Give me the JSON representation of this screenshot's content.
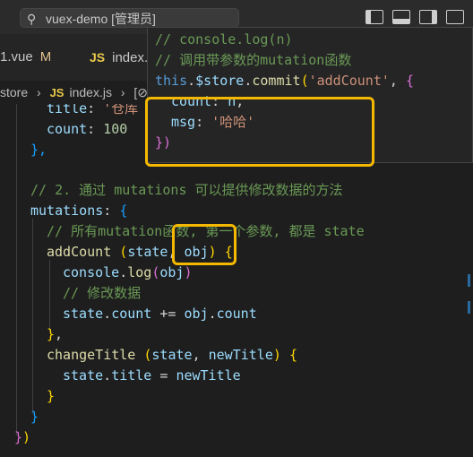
{
  "window": {
    "search_text": "vuex-demo [管理员]"
  },
  "tabs": [
    {
      "label": "1.vue",
      "modified": "M"
    },
    {
      "label": "index.j",
      "lang": "JS"
    }
  ],
  "breadcrumb": {
    "parts": [
      "store",
      "index.js",
      "[⊘]"
    ],
    "lang": "JS"
  },
  "code": {
    "line_title": {
      "key": "title",
      "value": "'仓库"
    },
    "line_count": {
      "key": "count",
      "value": "100"
    },
    "close_obj": "},",
    "comment2": "// 2. 通过 mutations 可以提供修改数据的方法",
    "mutations_key": "mutations",
    "comment_all": "// 所有mutation函数, 第一个参数, 都是 state",
    "addCount": {
      "name": "addCount",
      "param1": "state",
      "param2": "obj"
    },
    "console_log": {
      "obj": "console",
      "method": "log",
      "arg": "obj"
    },
    "comment_modify": "// 修改数据",
    "assign": {
      "lhs_obj": "state",
      "lhs_prop": "count",
      "op": "+=",
      "rhs_obj": "obj",
      "rhs_prop": "count"
    },
    "changeTitle": {
      "name": "changeTitle",
      "param1": "state",
      "param2": "newTitle"
    },
    "assign2": {
      "lhs_obj": "state",
      "lhs_prop": "title",
      "op": "=",
      "rhs": "newTitle"
    }
  },
  "hover": {
    "line1": "// console.log(n)",
    "line2": "// 调用带参数的mutation函数",
    "line3_this": "this",
    "line3_store": "$store",
    "line3_commit": "commit",
    "line3_arg": "'addCount'",
    "line4_key": "count",
    "line4_val": "n",
    "line5_key": "msg",
    "line5_val": "'哈哈'",
    "line6": "})"
  },
  "colors": {
    "highlight_box": "#f5b800",
    "comment": "#6a9955",
    "property": "#9cdcfe",
    "string": "#ce9178",
    "number": "#b5cea8",
    "function": "#dcdcaa"
  }
}
